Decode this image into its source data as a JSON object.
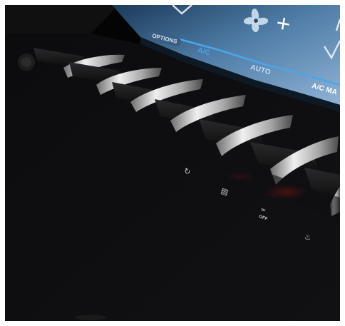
{
  "screen": {
    "options_label": "OPTIONS",
    "ac_label": "A/C",
    "auto_label": "AUTO",
    "ac_max_label": "A/C MA",
    "plus_symbol": "+",
    "accent_color": "#4aa6e8"
  },
  "panel": {
    "seat_heat_off_label": "OFF",
    "sliver_color": "#c8c8c8",
    "glow_color": "#d21a14"
  },
  "icons": [
    "fan-icon",
    "plus-icon",
    "vent-flow-icon",
    "recirculation-icon",
    "rear-defrost-icon",
    "seat-heat-off-icon",
    "seat-heat-icon"
  ]
}
